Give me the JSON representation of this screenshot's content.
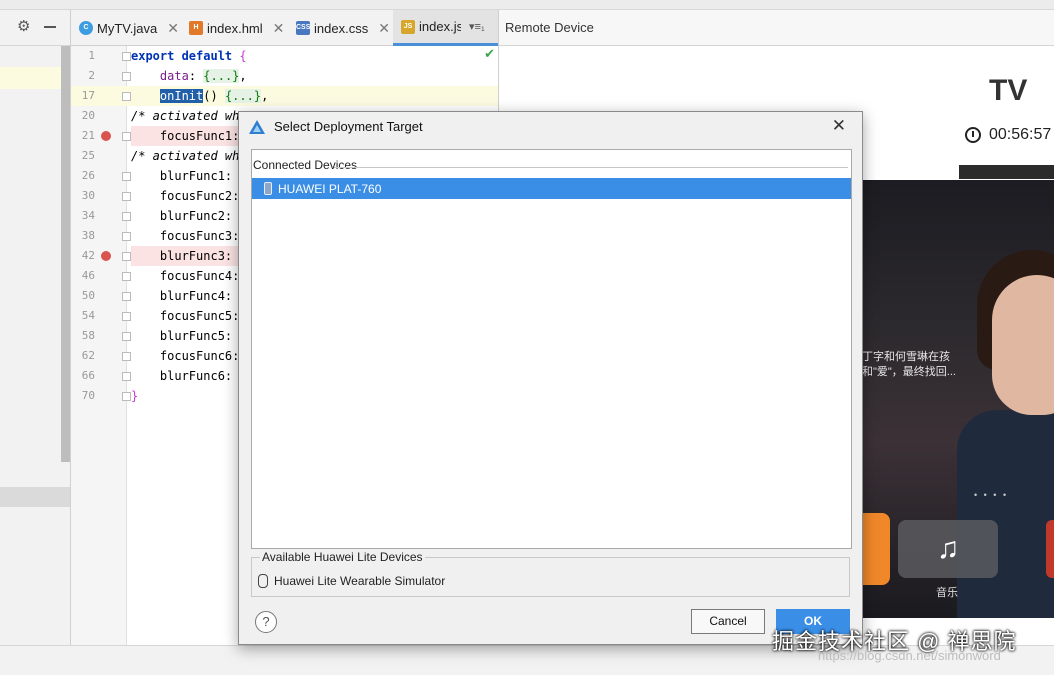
{
  "tabs": [
    {
      "label": "MyTV.java",
      "icon": "java-file-icon",
      "color": "#3d9de0",
      "glyph": "C"
    },
    {
      "label": "index.hml",
      "icon": "hml-file-icon",
      "color": "#e07a2a",
      "glyph": "H"
    },
    {
      "label": "index.css",
      "icon": "css-file-icon",
      "color": "#4a78c0",
      "glyph": "CSS"
    },
    {
      "label": "index.js",
      "icon": "js-file-icon",
      "color": "#d6a72a",
      "glyph": "JS"
    }
  ],
  "tab_overflow": "▾≡₁",
  "editor": {
    "lines": [
      {
        "num": "1"
      },
      {
        "num": "2"
      },
      {
        "num": "17"
      },
      {
        "num": "20"
      },
      {
        "num": "21"
      },
      {
        "num": "25"
      },
      {
        "num": "26"
      },
      {
        "num": "30"
      },
      {
        "num": "34"
      },
      {
        "num": "38"
      },
      {
        "num": "42"
      },
      {
        "num": "46"
      },
      {
        "num": "50"
      },
      {
        "num": "54"
      },
      {
        "num": "58"
      },
      {
        "num": "62"
      },
      {
        "num": "66"
      },
      {
        "num": "70"
      }
    ],
    "code": {
      "l1a": "export default ",
      "l1b": "{",
      "l2a": "data",
      "l2b": ": ",
      "l2c": "{...}",
      "l2d": ",",
      "l17a": "onInit",
      "l17b": "() ",
      "l17c": "{...}",
      "l17d": ",",
      "l20": "/* activated wh",
      "l21": "focusFunc1:",
      "l25": "/* activated wh",
      "l26": "blurFunc1:",
      "l30": "focusFunc2:",
      "l34": "blurFunc2: ",
      "l38": "focusFunc3:",
      "l42": "blurFunc3: ",
      "l46": "focusFunc4:",
      "l50": "blurFunc4: ",
      "l54": "focusFunc5:",
      "l58": "blurFunc5: ",
      "l62": "focusFunc6:",
      "l66": "blurFunc6: ",
      "l70": "}"
    }
  },
  "remote": {
    "header": "Remote Device",
    "tv_title": "TV",
    "clock": "00:56:57",
    "subtitle_line1": "丁字和何雪琳在孩",
    "subtitle_line2": "和\"爱\"，最终找回...",
    "dots": "• • • •",
    "music_label": "音乐",
    "music_icon": "♫"
  },
  "dialog": {
    "title": "Select Deployment Target",
    "connected_label": "Connected Devices",
    "device": "HUAWEI PLAT-760",
    "available_label": "Available Huawei Lite Devices",
    "simulator": "Huawei Lite Wearable Simulator",
    "help": "?",
    "cancel": "Cancel",
    "ok": "OK"
  },
  "watermark": {
    "main": "掘金技术社区 @ 禅思院",
    "url": "https://blog.csdn.net/simonword"
  }
}
